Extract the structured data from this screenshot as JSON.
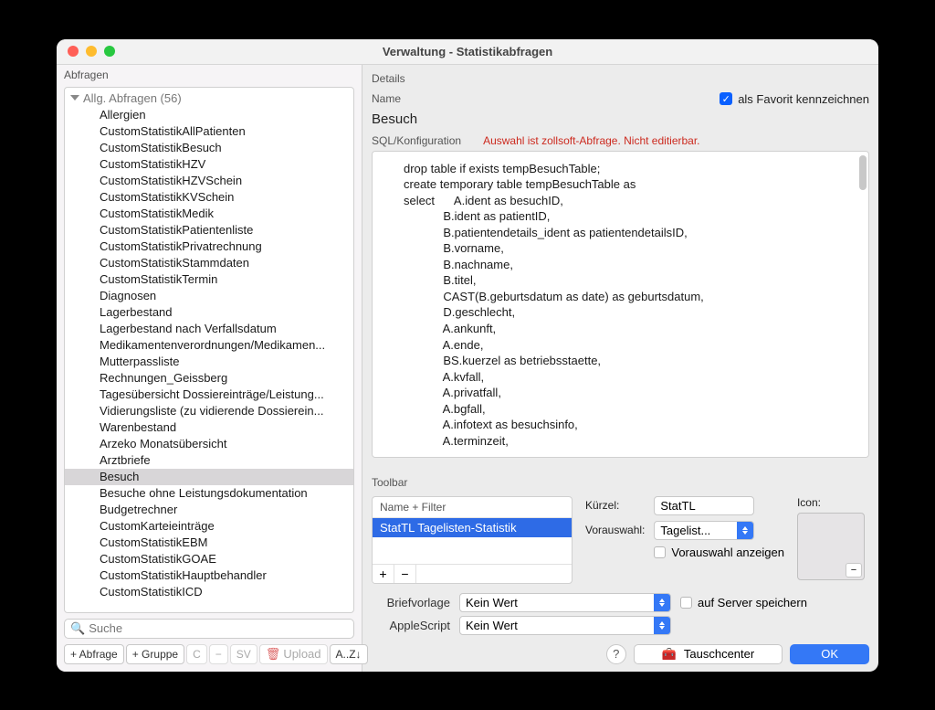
{
  "window": {
    "title": "Verwaltung - Statistikabfragen"
  },
  "left": {
    "section": "Abfragen",
    "group": "Allg. Abfragen (56)",
    "selected": "Besuch",
    "items": [
      "Allergien",
      "CustomStatistikAllPatienten",
      "CustomStatistikBesuch",
      "CustomStatistikHZV",
      "CustomStatistikHZVSchein",
      "CustomStatistikKVSchein",
      "CustomStatistikMedik",
      "CustomStatistikPatientenliste",
      "CustomStatistikPrivatrechnung",
      "CustomStatistikStammdaten",
      "CustomStatistikTermin",
      "Diagnosen",
      "Lagerbestand",
      "Lagerbestand nach Verfallsdatum",
      "Medikamentenverordnungen/Medikamen...",
      "Mutterpassliste",
      "Rechnungen_Geissberg",
      "Tagesübersicht Dossiereinträge/Leistung...",
      "Vidierungsliste (zu vidierende Dossierein...",
      "Warenbestand",
      "Arzeko Monatsübersicht",
      "Arztbriefe",
      "Besuch",
      "Besuche ohne Leistungsdokumentation",
      "Budgetrechner",
      "CustomKarteieinträge",
      "CustomStatistikEBM",
      "CustomStatistikGOAE",
      "CustomStatistikHauptbehandler",
      "CustomStatistikICD"
    ],
    "search_placeholder": "Suche",
    "buttons": {
      "add_query": "+ Abfrage",
      "add_group": "+ Gruppe",
      "c": "C",
      "minus": "−",
      "sv": "SV",
      "upload": "Upload",
      "sort": "A..Z↓"
    }
  },
  "details": {
    "section": "Details",
    "name_label": "Name",
    "favorite_label": "als Favorit kennzeichnen",
    "favorite_checked": true,
    "name_value": "Besuch",
    "sql_label": "SQL/Konfiguration",
    "warning": "Auswahl ist zollsoft-Abfrage. Nicht editierbar.",
    "sql": "drop table if exists tempBesuchTable;\ncreate temporary table tempBesuchTable as\nselect      A.ident as besuchID,\n            B.ident as patientID,\n            B.patientendetails_ident as patientendetailsID,\n            B.vorname,\n            B.nachname,\n            B.titel,\n            CAST(B.geburtsdatum as date) as geburtsdatum,\n            D.geschlecht,\n            A.ankunft,\n            A.ende,\n            BS.kuerzel as betriebsstaette,\n            A.kvfall,\n            A.privatfall,\n            A.bgfall,\n            A.infotext as besuchsinfo,\n            A.terminzeit,"
  },
  "toolbar": {
    "section": "Toolbar",
    "list_header": "Name + Filter",
    "list_item": "StatTL Tagelisten-Statistik",
    "kuerzel_label": "Kürzel:",
    "kuerzel_value": "StatTL",
    "vorauswahl_label": "Vorauswahl:",
    "vorauswahl_value": "Tagelist...",
    "vorauswahl_show": "Vorauswahl anzeigen",
    "icon_label": "Icon:"
  },
  "bottom": {
    "briefvorlage_label": "Briefvorlage",
    "briefvorlage_value": "Kein Wert",
    "applescript_label": "AppleScript",
    "applescript_value": "Kein Wert",
    "server_label": "auf Server speichern",
    "help": "?",
    "tausch": "Tauschcenter",
    "ok": "OK"
  }
}
